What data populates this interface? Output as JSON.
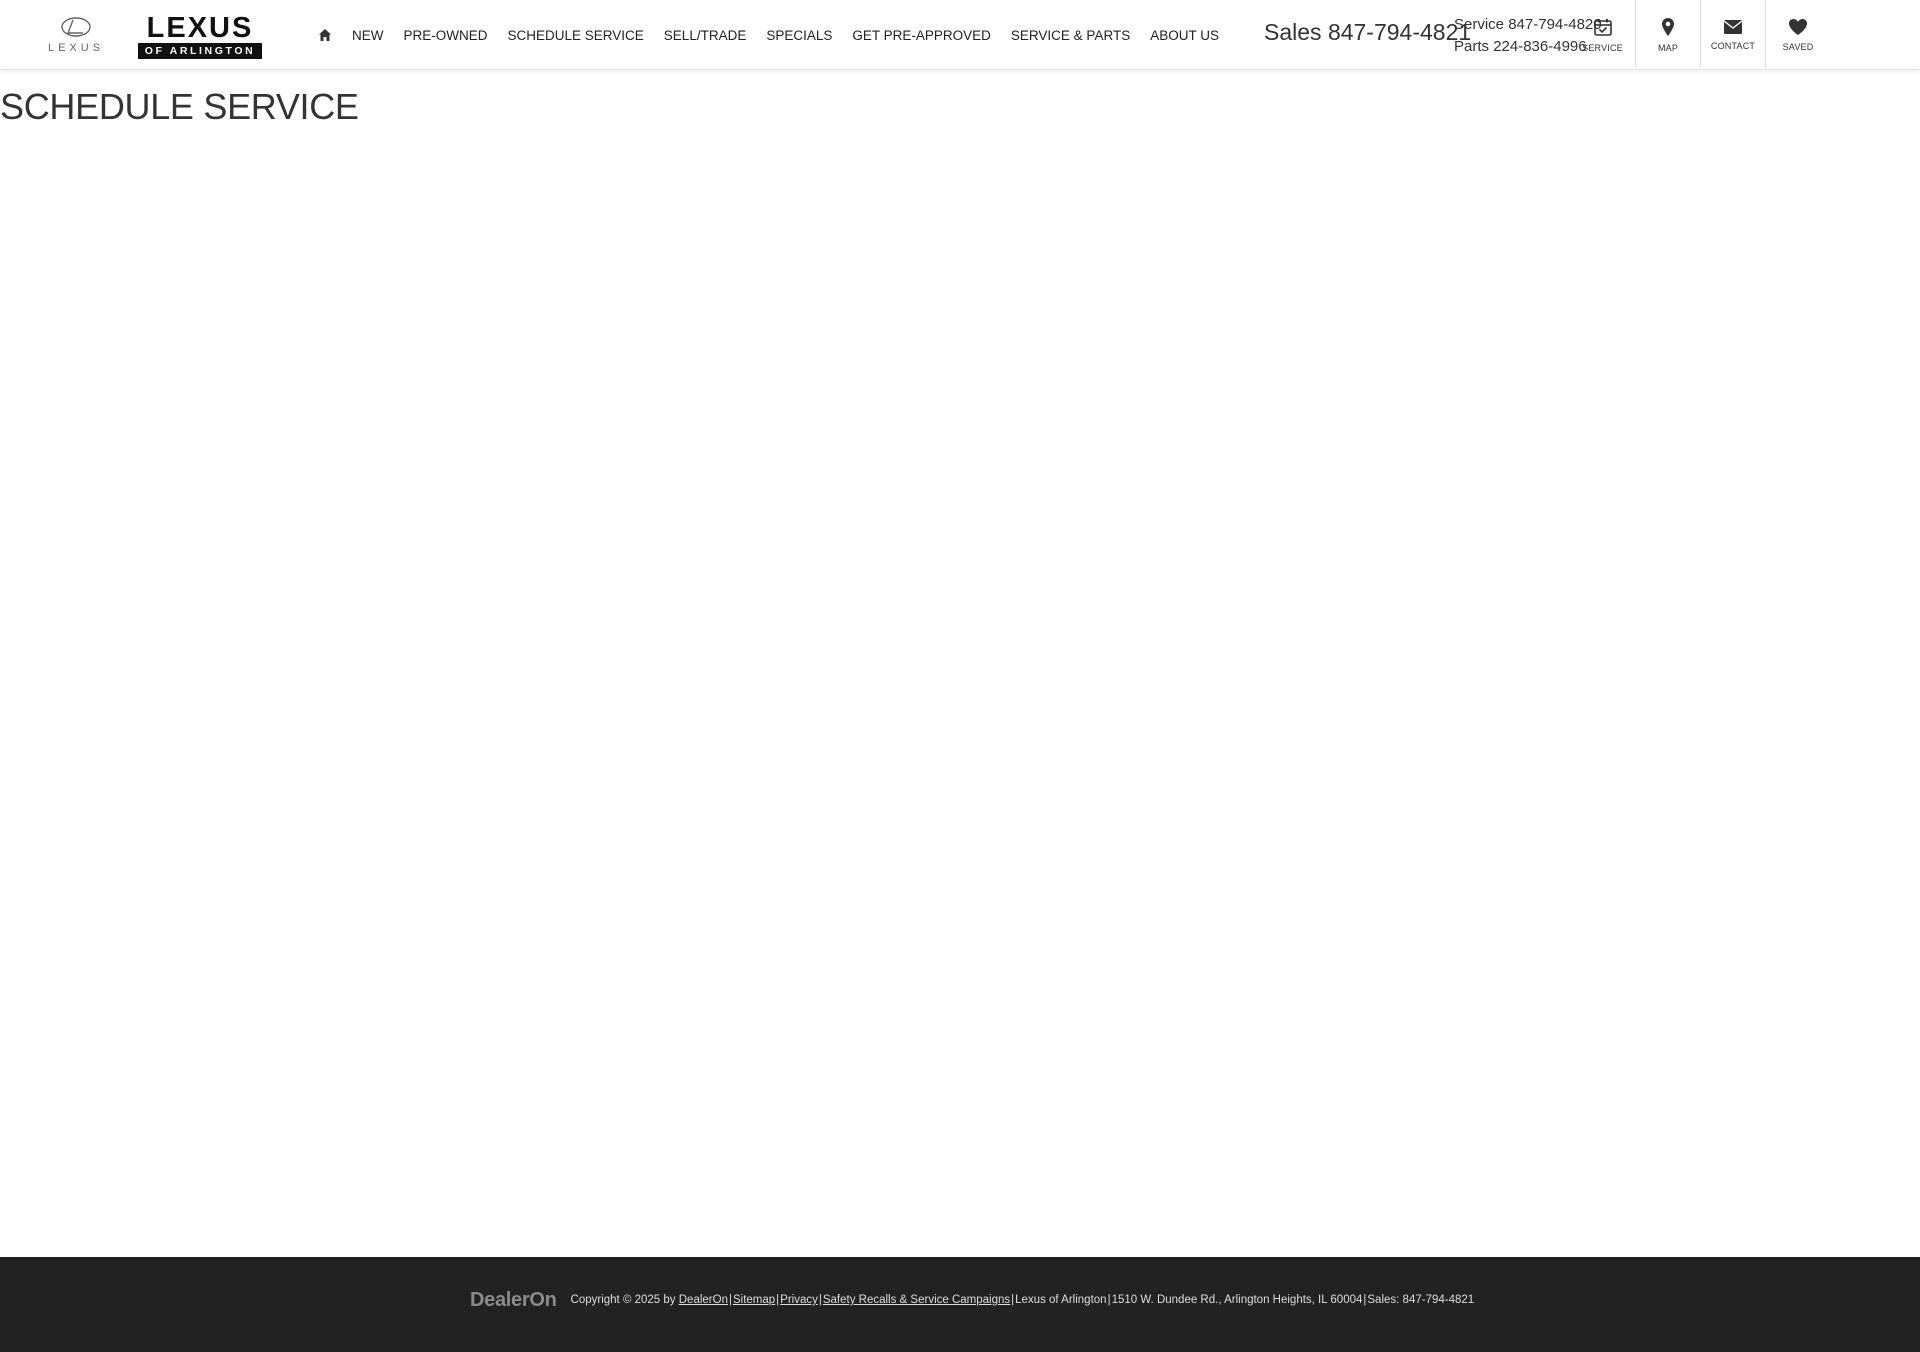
{
  "header": {
    "brand_mark_text": "LEXUS",
    "dealer_logo": {
      "word": "LEXUS",
      "sub": "OF ARLINGTON"
    },
    "nav": [
      "NEW",
      "PRE-OWNED",
      "SCHEDULE SERVICE",
      "SELL/TRADE",
      "SPECIALS",
      "GET PRE-APPROVED",
      "SERVICE & PARTS",
      "ABOUT US"
    ],
    "sales": {
      "label": "Sales",
      "number": "847-794-4821"
    },
    "service": {
      "label": "Service",
      "number": "847-794-4820"
    },
    "parts": {
      "label": "Parts",
      "number": "224-836-4996"
    },
    "utility": [
      {
        "label": "SERVICE",
        "icon": "calendar-check-icon"
      },
      {
        "label": "MAP",
        "icon": "map-marker-icon"
      },
      {
        "label": "CONTACT",
        "icon": "envelope-icon"
      },
      {
        "label": "SAVED",
        "icon": "heart-icon"
      }
    ]
  },
  "main": {
    "title": "SCHEDULE SERVICE"
  },
  "footer": {
    "brand": "DealerOn",
    "copyright": "Copyright © 2025 by",
    "links": [
      "DealerOn",
      "Sitemap",
      "Privacy",
      "Safety Recalls & Service Campaigns"
    ],
    "dealer_name": "Lexus of Arlington",
    "address": "1510 W. Dundee Rd., Arlington Heights, IL 60004",
    "sales": "Sales: 847-794-4821"
  },
  "colors": {
    "footer_bg": "#222222",
    "text": "#333333",
    "logo_black": "#111111"
  }
}
